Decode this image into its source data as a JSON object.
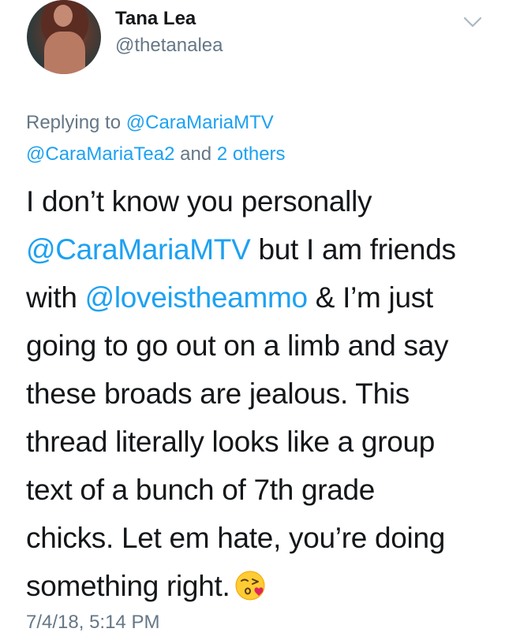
{
  "author": {
    "name": "Tana Lea",
    "handle": "@thetanalea"
  },
  "reply": {
    "prefix": "Replying to ",
    "mention1": "@CaraMariaMTV",
    "mention2": "@CaraMariaTea2",
    "connector": " and ",
    "others": "2 others"
  },
  "body": {
    "line1": "I don’t know you personally",
    "line2_mention": "@CaraMariaMTV",
    "line2_rest": " but I am friends",
    "line3_pre": "with ",
    "line3_mention": "@loveistheammo",
    "line3_rest": " & I’m just",
    "line4": "going to go out on a limb and say",
    "line5": "these broads are jealous. This",
    "line6": "thread literally looks like a group",
    "line7": "text of a bunch of 7th grade",
    "line8": "chicks. Let em hate, you’re doing",
    "line9": "something right."
  },
  "emoji": "face-blowing-kiss-icon",
  "timestamp": "7/4/18, 5:14 PM",
  "colors": {
    "link": "#1da1f2",
    "secondary": "#657786",
    "text": "#14171a"
  }
}
